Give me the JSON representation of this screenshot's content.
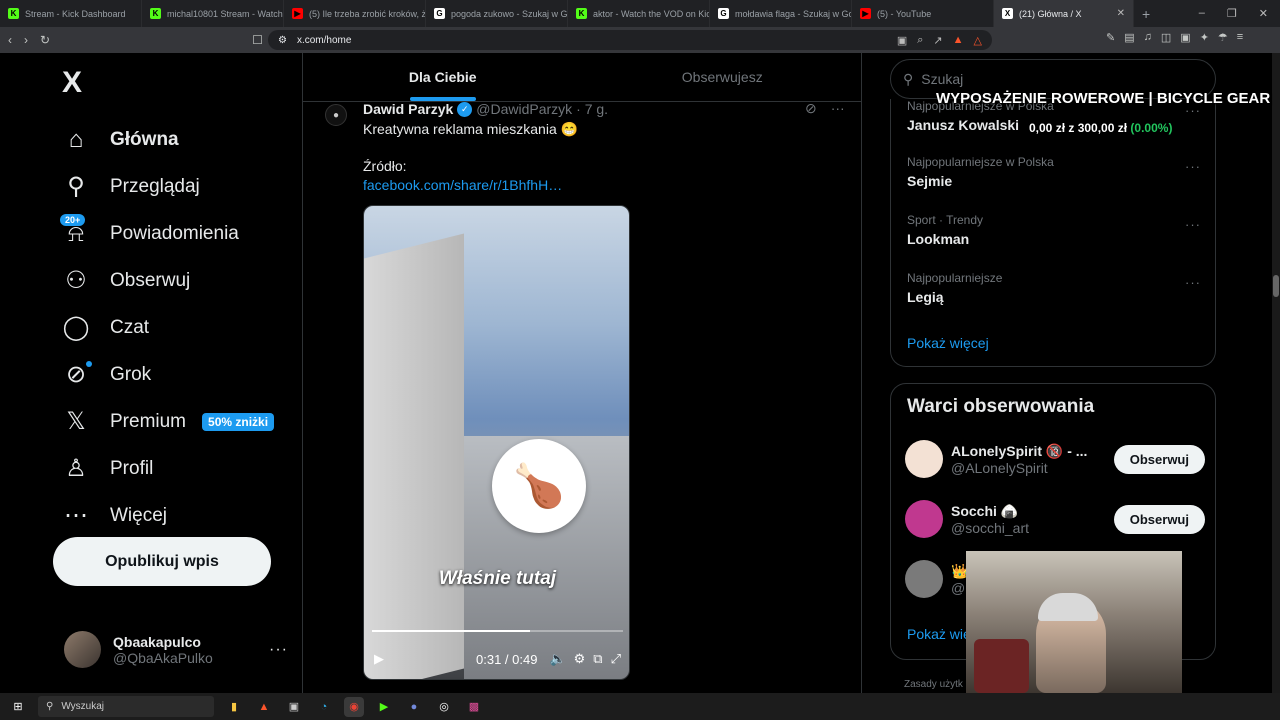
{
  "browser": {
    "tabs": [
      {
        "title": "Stream - Kick Dashboard",
        "icon": "K",
        "color": "#53fc18"
      },
      {
        "title": "michal10801 Stream - Watch L",
        "icon": "K",
        "color": "#53fc18"
      },
      {
        "title": "(5) Ile trzeba zrobić kroków, że",
        "icon": "▶",
        "color": "#ff0000"
      },
      {
        "title": "pogoda zukowo - Szukaj w Go",
        "icon": "G",
        "color": "#ffffff"
      },
      {
        "title": "aktor - Watch the VOD on Kick",
        "icon": "K",
        "color": "#53fc18"
      },
      {
        "title": "mołdawia flaga - Szukaj w Goo",
        "icon": "G",
        "color": "#ffffff"
      },
      {
        "title": "(5)                - YouTube",
        "icon": "▶",
        "color": "#ff0000"
      },
      {
        "title": "(21) Główna / X",
        "icon": "X",
        "color": "#ffffff",
        "active": true
      }
    ],
    "url": "x.com/home"
  },
  "sidebar": {
    "logo": "X",
    "items": [
      {
        "label": "Główna",
        "icon": "home-icon",
        "bold": true
      },
      {
        "label": "Przeglądaj",
        "icon": "search-icon"
      },
      {
        "label": "Powiadomienia",
        "icon": "bell-icon",
        "badge": "20+"
      },
      {
        "label": "Obserwuj",
        "icon": "person-add-icon"
      },
      {
        "label": "Czat",
        "icon": "chat-icon"
      },
      {
        "label": "Grok",
        "icon": "grok-icon"
      },
      {
        "label": "Premium",
        "icon": "x-icon",
        "tag": "50% zniżki"
      },
      {
        "label": "Profil",
        "icon": "person-icon"
      },
      {
        "label": "Więcej",
        "icon": "more-circle-icon"
      }
    ],
    "post_button": "Opublikuj wpis",
    "profile": {
      "name": "Qbaakapulco",
      "handle": "@QbaAkaPulko"
    }
  },
  "feed": {
    "tabs": [
      "Dla Ciebie",
      "Obserwujesz"
    ],
    "tweet": {
      "name": "Dawid Parzyk",
      "handle": "@DawidParzyk",
      "time": "· 7 g.",
      "text": "Kreatywna reklama mieszkania 😁",
      "source_label": "Źródło:",
      "link": "facebook.com/share/r/1BhfhH…",
      "video": {
        "caption": "Właśnie tutaj",
        "time": "0:31 / 0:49",
        "progress": 0.63
      }
    }
  },
  "right": {
    "search_placeholder": "Szukaj",
    "trends": [
      {
        "context": "Najpopularniejsze w Polska",
        "name": "Janusz Kowalski"
      },
      {
        "context": "Najpopularniejsze w Polska",
        "name": "Sejmie"
      },
      {
        "context": "Sport · Trendy",
        "name": "Lookman"
      },
      {
        "context": "Najpopularniejsze",
        "name": "Legią"
      }
    ],
    "trends_more": "Pokaż więcej",
    "follow_title": "Warci obserwowania",
    "follow": [
      {
        "name": "ALonelySpirit 🔞 - ...",
        "handle": "@ALonelySpirit",
        "button": "Obserwuj",
        "color": "#f3e1d4"
      },
      {
        "name": "Socchi 🍙",
        "handle": "@socchi_art",
        "button": "Obserwuj",
        "color": "#c0388f"
      },
      {
        "name": "👑",
        "handle": "@",
        "button": "",
        "color": "#7a7a7a"
      }
    ],
    "follow_more": "Pokaż wię",
    "footer": "Zasady użytk"
  },
  "overlay": {
    "title": "WYPOSAŻENIE ROWEROWE | BICYCLE GEAR",
    "amount": "0,00 zł",
    "sep": " z ",
    "goal": "300,00 zł",
    "pct": "(0.00%)"
  },
  "taskbar": {
    "search": "Wyszukaj"
  }
}
